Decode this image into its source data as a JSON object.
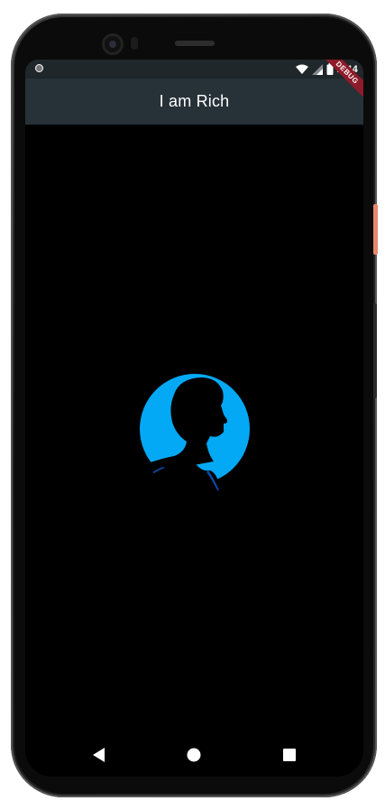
{
  "status_bar": {
    "time": "2:44",
    "icons": [
      "notification-dot-icon",
      "wifi-icon",
      "signal-icon",
      "battery-icon"
    ]
  },
  "debug_banner": {
    "label": "DEBUG"
  },
  "app_bar": {
    "title": "I am Rich",
    "background": "#263238"
  },
  "body": {
    "background": "#000000",
    "image": {
      "icon": "person-silhouette-icon",
      "accent": "#03a9f4"
    }
  },
  "nav_bar": {
    "buttons": [
      "back-icon",
      "home-icon",
      "recents-icon"
    ]
  }
}
